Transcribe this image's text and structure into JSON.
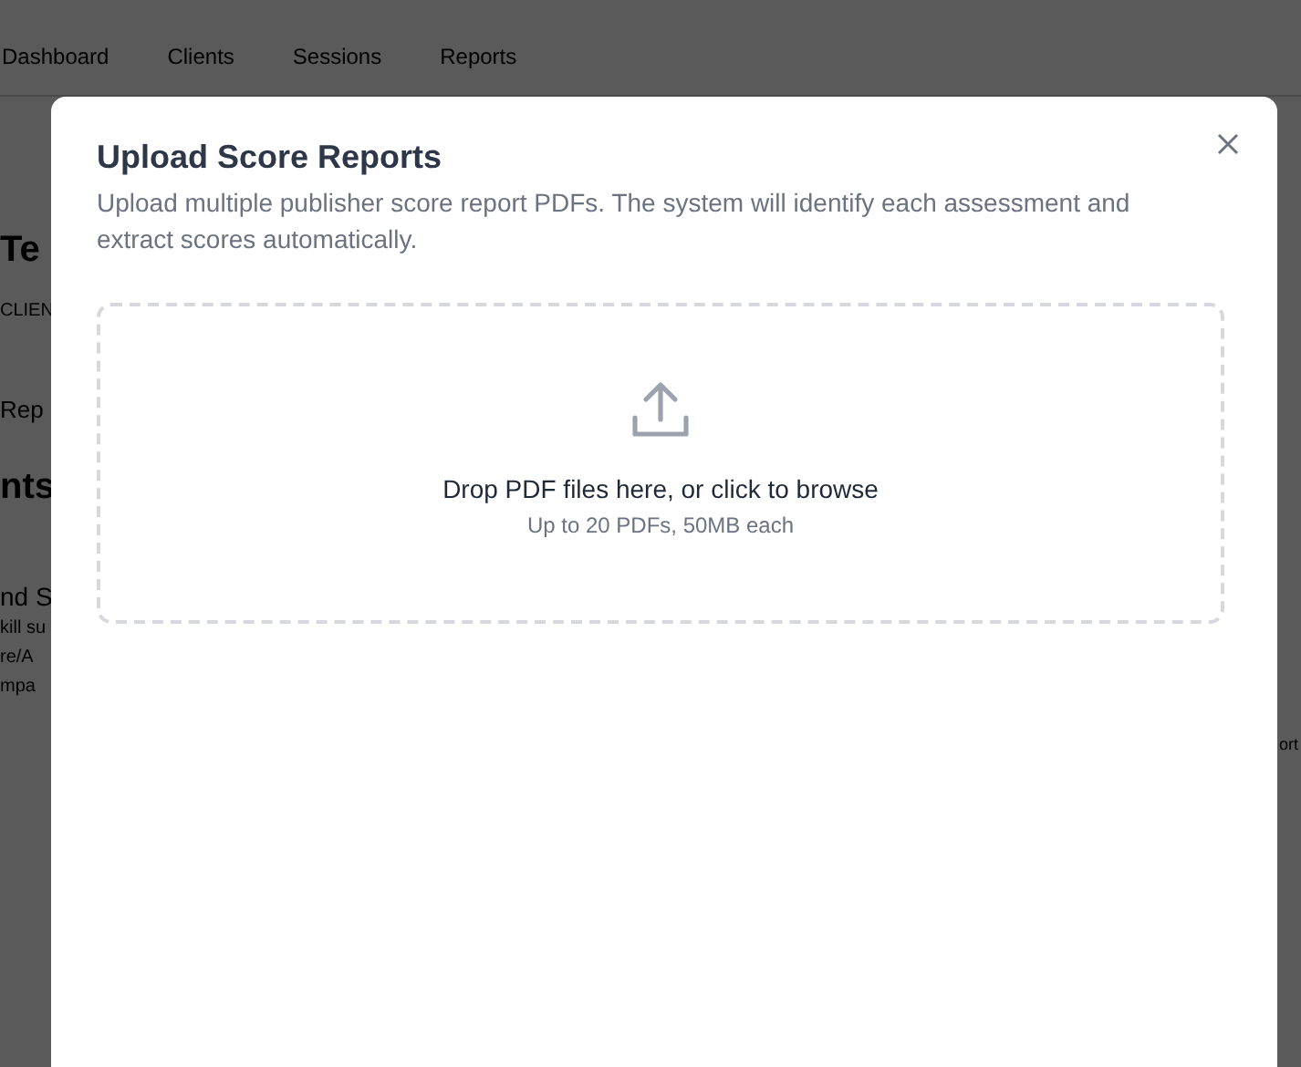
{
  "nav": {
    "items": [
      "Dashboard",
      "Clients",
      "Sessions",
      "Reports"
    ]
  },
  "background": {
    "left_fragments": [
      {
        "kind": "heading",
        "text": "Te"
      },
      {
        "kind": "caps",
        "text": "CLIEN"
      },
      {
        "kind": "body",
        "text": "Rep"
      },
      {
        "kind": "heading",
        "text": "nts"
      },
      {
        "kind": "subheading",
        "text": "nd S"
      },
      {
        "kind": "small",
        "text": "kill su"
      },
      {
        "kind": "small",
        "text": "re/A"
      },
      {
        "kind": "small",
        "text": "mpa"
      }
    ],
    "right_fragments": [
      {
        "kind": "body",
        "text": "ort"
      }
    ]
  },
  "dialog": {
    "title": "Upload Score Reports",
    "description": "Upload multiple publisher score report PDFs. The system will identify each assessment and extract scores automatically.",
    "dropzone": {
      "text": "Drop PDF files here, or click to browse",
      "hint": "Up to 20 PDFs, 50MB each"
    }
  }
}
